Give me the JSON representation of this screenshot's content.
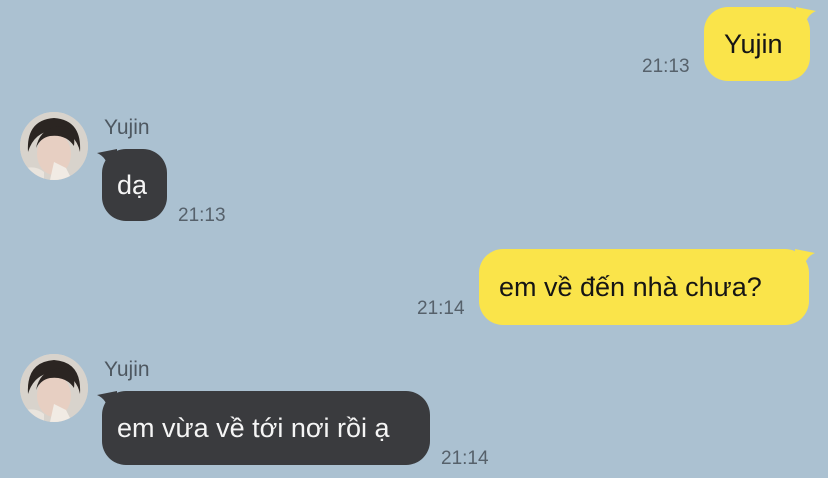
{
  "chat": {
    "messages": [
      {
        "direction": "outgoing",
        "text": "Yujin",
        "time": "21:13"
      },
      {
        "direction": "incoming",
        "sender": "Yujin",
        "text": "dạ",
        "time": "21:13"
      },
      {
        "direction": "outgoing",
        "text": "em về đến nhà chưa?",
        "time": "21:14"
      },
      {
        "direction": "incoming",
        "sender": "Yujin",
        "text": "em vừa về tới nơi rồi ạ",
        "time": "21:14"
      }
    ]
  },
  "colors": {
    "background": "#abc1d1",
    "outgoing_bubble": "#fae44a",
    "incoming_bubble": "#3a3b3e"
  },
  "icons": {
    "avatar": "profile-photo-avatar"
  }
}
